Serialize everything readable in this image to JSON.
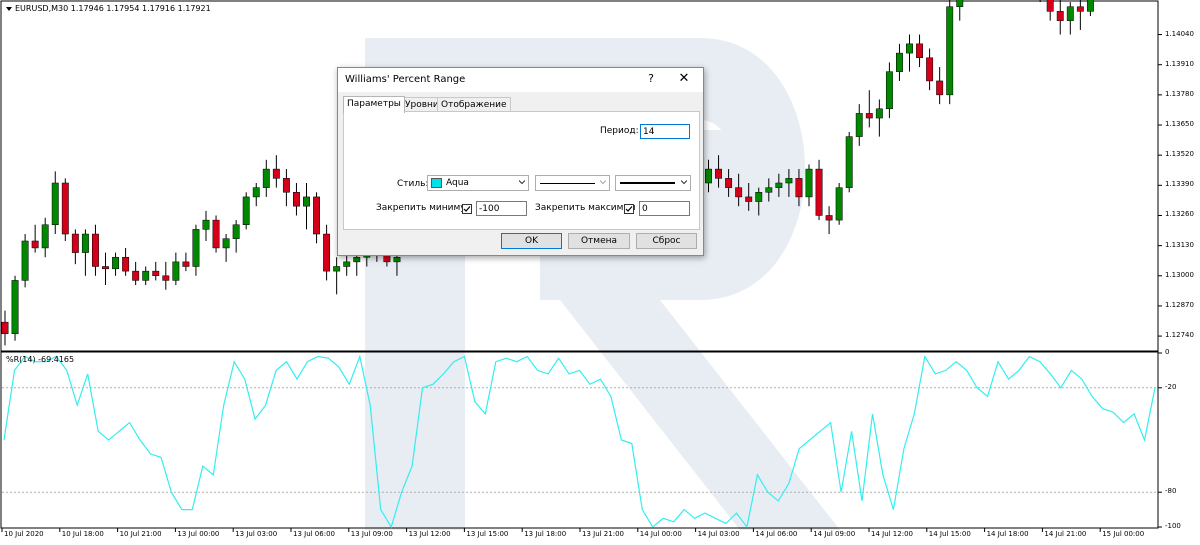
{
  "chart_header": {
    "symbol_line": "EURUSD,M30  1.17946 1.17954 1.17916 1.17921"
  },
  "indicator_header": {
    "text": "%R(14) -69.4165"
  },
  "price_axis": [
    "1.14040",
    "1.13910",
    "1.13780",
    "1.13650",
    "1.13520",
    "1.13390",
    "1.13260",
    "1.13130",
    "1.13000",
    "1.12870",
    "1.12740"
  ],
  "indicator_axis": [
    "0",
    "-20",
    "-80",
    "-100"
  ],
  "time_axis": [
    "10 Jul 2020",
    "10 Jul 18:00",
    "10 Jul 21:00",
    "13 Jul 00:00",
    "13 Jul 03:00",
    "13 Jul 06:00",
    "13 Jul 09:00",
    "13 Jul 12:00",
    "13 Jul 15:00",
    "13 Jul 18:00",
    "13 Jul 21:00",
    "14 Jul 00:00",
    "14 Jul 03:00",
    "14 Jul 06:00",
    "14 Jul 09:00",
    "14 Jul 12:00",
    "14 Jul 15:00",
    "14 Jul 18:00",
    "14 Jul 21:00",
    "15 Jul 00:00"
  ],
  "colors": {
    "bull": "#008800",
    "bear": "#d4001a",
    "wr_line": "#33eeee",
    "watermark": "#e8ecf3",
    "aqua_swatch": "#00e0e8"
  },
  "chart_data": {
    "type": "line",
    "price": {
      "ohlc": [
        [
          1.128,
          1.1285,
          1.127,
          1.1275
        ],
        [
          1.1275,
          1.13,
          1.1272,
          1.1298
        ],
        [
          1.1298,
          1.1318,
          1.1295,
          1.1315
        ],
        [
          1.1315,
          1.1322,
          1.131,
          1.1312
        ],
        [
          1.1312,
          1.1325,
          1.1308,
          1.1322
        ],
        [
          1.1322,
          1.1345,
          1.1318,
          1.134
        ],
        [
          1.134,
          1.1342,
          1.1315,
          1.1318
        ],
        [
          1.1318,
          1.132,
          1.1305,
          1.131
        ],
        [
          1.131,
          1.132,
          1.13,
          1.1318
        ],
        [
          1.1318,
          1.1322,
          1.13,
          1.1304
        ],
        [
          1.1304,
          1.131,
          1.1296,
          1.1303
        ],
        [
          1.1303,
          1.131,
          1.13,
          1.1308
        ],
        [
          1.1308,
          1.1312,
          1.13,
          1.1302
        ],
        [
          1.1302,
          1.1306,
          1.1296,
          1.1298
        ],
        [
          1.1298,
          1.1304,
          1.1296,
          1.1302
        ],
        [
          1.1302,
          1.1306,
          1.1298,
          1.13
        ],
        [
          1.13,
          1.1306,
          1.1294,
          1.1298
        ],
        [
          1.1298,
          1.131,
          1.1296,
          1.1306
        ],
        [
          1.1306,
          1.131,
          1.1302,
          1.1304
        ],
        [
          1.1304,
          1.1322,
          1.13,
          1.132
        ],
        [
          1.132,
          1.1328,
          1.1315,
          1.1324
        ],
        [
          1.1324,
          1.1326,
          1.131,
          1.1312
        ],
        [
          1.1312,
          1.1318,
          1.1306,
          1.1316
        ],
        [
          1.1316,
          1.1324,
          1.131,
          1.1322
        ],
        [
          1.1322,
          1.1336,
          1.132,
          1.1334
        ],
        [
          1.1334,
          1.134,
          1.133,
          1.1338
        ],
        [
          1.1338,
          1.135,
          1.1334,
          1.1346
        ],
        [
          1.1346,
          1.1352,
          1.1338,
          1.1342
        ],
        [
          1.1342,
          1.1346,
          1.133,
          1.1336
        ],
        [
          1.1336,
          1.134,
          1.1326,
          1.133
        ],
        [
          1.133,
          1.134,
          1.132,
          1.1334
        ],
        [
          1.1334,
          1.1336,
          1.1314,
          1.1318
        ],
        [
          1.1318,
          1.1322,
          1.1298,
          1.1302
        ],
        [
          1.1302,
          1.1308,
          1.1292,
          1.1304
        ],
        [
          1.1304,
          1.1312,
          1.13,
          1.1306
        ],
        [
          1.1306,
          1.1312,
          1.13,
          1.1308
        ],
        [
          1.1308,
          1.1316,
          1.1304,
          1.1312
        ],
        [
          1.1312,
          1.1318,
          1.1306,
          1.131
        ],
        [
          1.131,
          1.1316,
          1.1304,
          1.1306
        ],
        [
          1.1306,
          1.1312,
          1.13,
          1.1308
        ],
        [
          1.1308,
          1.1314,
          1.1302,
          1.1304
        ],
        [
          1.1304,
          1.131,
          1.1298,
          1.1306
        ],
        [
          1.1306,
          1.1312,
          1.13,
          1.1304
        ],
        [
          1.1304,
          1.131,
          1.1298,
          1.1302
        ],
        [
          1.1302,
          1.1308,
          1.1296,
          1.13
        ],
        [
          1.13,
          1.1306,
          1.1294,
          1.1298
        ],
        [
          1.1298,
          1.1304,
          1.1292,
          1.1296
        ],
        [
          1.1296,
          1.13,
          1.129,
          1.1294
        ],
        [
          1.1294,
          1.13,
          1.1288,
          1.1292
        ],
        [
          1.1292,
          1.1298,
          1.1286,
          1.129
        ],
        [
          1.129,
          1.1296,
          1.1284,
          1.1288
        ],
        [
          1.1288,
          1.1294,
          1.1282,
          1.1286
        ],
        [
          1.1286,
          1.1292,
          1.128,
          1.1284
        ],
        [
          1.1284,
          1.129,
          1.1278,
          1.1282
        ],
        [
          1.1282,
          1.1288,
          1.1276,
          1.128
        ],
        [
          1.128,
          1.1286,
          1.1274,
          1.1278
        ],
        [
          1.1278,
          1.1284,
          1.1272,
          1.1276
        ],
        [
          1.1276,
          1.1282,
          1.127,
          1.1274
        ],
        [
          1.1274,
          1.128,
          1.1268,
          1.1272
        ],
        [
          1.1272,
          1.1278,
          1.1266,
          1.127
        ],
        [
          1.127,
          1.1276,
          1.1264,
          1.1268
        ],
        [
          1.1268,
          1.1274,
          1.1262,
          1.1266
        ],
        [
          1.1266,
          1.1272,
          1.126,
          1.1264
        ],
        [
          1.1264,
          1.127,
          1.1258,
          1.1262
        ],
        [
          1.1262,
          1.1268,
          1.1256,
          1.126
        ],
        [
          1.126,
          1.1266,
          1.1254,
          1.1258
        ],
        [
          1.1258,
          1.1264,
          1.1252,
          1.1256
        ],
        [
          1.1256,
          1.1262,
          1.125,
          1.1254
        ],
        [
          1.1254,
          1.126,
          1.1248,
          1.1252
        ],
        [
          1.1252,
          1.1258,
          1.1246,
          1.125
        ],
        [
          1.134,
          1.135,
          1.1336,
          1.1346
        ],
        [
          1.1346,
          1.1352,
          1.1338,
          1.1342
        ],
        [
          1.1342,
          1.1346,
          1.1334,
          1.1338
        ],
        [
          1.1338,
          1.1344,
          1.133,
          1.1334
        ],
        [
          1.1334,
          1.134,
          1.1328,
          1.1332
        ],
        [
          1.1332,
          1.1338,
          1.1326,
          1.1336
        ],
        [
          1.1336,
          1.1342,
          1.1332,
          1.1338
        ],
        [
          1.1338,
          1.1344,
          1.1334,
          1.134
        ],
        [
          1.134,
          1.1346,
          1.1334,
          1.1342
        ],
        [
          1.1342,
          1.1346,
          1.133,
          1.1334
        ],
        [
          1.1334,
          1.1348,
          1.133,
          1.1346
        ],
        [
          1.1346,
          1.135,
          1.1324,
          1.1326
        ],
        [
          1.1326,
          1.133,
          1.1318,
          1.1324
        ],
        [
          1.1324,
          1.134,
          1.1322,
          1.1338
        ],
        [
          1.1338,
          1.1362,
          1.1336,
          1.136
        ],
        [
          1.136,
          1.1374,
          1.1356,
          1.137
        ],
        [
          1.137,
          1.138,
          1.1364,
          1.1368
        ],
        [
          1.1368,
          1.1376,
          1.136,
          1.1372
        ],
        [
          1.1372,
          1.1392,
          1.1368,
          1.1388
        ],
        [
          1.1388,
          1.14,
          1.1384,
          1.1396
        ],
        [
          1.1396,
          1.1404,
          1.1388,
          1.14
        ],
        [
          1.14,
          1.1404,
          1.139,
          1.1394
        ],
        [
          1.1394,
          1.1398,
          1.138,
          1.1384
        ],
        [
          1.1384,
          1.139,
          1.1374,
          1.1378
        ],
        [
          1.1378,
          1.142,
          1.1374,
          1.1416
        ],
        [
          1.1416,
          1.144,
          1.141,
          1.1436
        ],
        [
          1.1436,
          1.1444,
          1.1428,
          1.1432
        ],
        [
          1.1432,
          1.1438,
          1.142,
          1.1424
        ],
        [
          1.1424,
          1.145,
          1.142,
          1.1446
        ],
        [
          1.1446,
          1.1452,
          1.1436,
          1.144
        ],
        [
          1.144,
          1.1446,
          1.1432,
          1.1438
        ],
        [
          1.1438,
          1.1442,
          1.1426,
          1.143
        ],
        [
          1.143,
          1.144,
          1.1424,
          1.1436
        ],
        [
          1.1436,
          1.144,
          1.1418,
          1.1422
        ],
        [
          1.1422,
          1.1426,
          1.141,
          1.1414
        ],
        [
          1.1414,
          1.142,
          1.1404,
          1.141
        ],
        [
          1.141,
          1.1418,
          1.1404,
          1.1416
        ],
        [
          1.1416,
          1.142,
          1.1406,
          1.1414
        ],
        [
          1.1414,
          1.1432,
          1.1412,
          1.143
        ],
        [
          1.143,
          1.1436,
          1.1422,
          1.1426
        ],
        [
          1.1426,
          1.144,
          1.142,
          1.1436
        ]
      ],
      "ylim": [
        1.1268,
        1.1412
      ]
    },
    "series": [
      {
        "name": "%R(14)",
        "values": [
          -50,
          -10,
          -2,
          -5,
          -5,
          -2,
          -10,
          -30,
          -12,
          -45,
          -50,
          -45,
          -40,
          -50,
          -58,
          -60,
          -80,
          -90,
          -90,
          -65,
          -70,
          -30,
          -5,
          -15,
          -38,
          -30,
          -10,
          -5,
          -15,
          -5,
          -2,
          -3,
          -8,
          -18,
          -2,
          -30,
          -90,
          -100,
          -80,
          -65,
          -20,
          -18,
          -12,
          -5,
          -2,
          -28,
          -35,
          -5,
          -3,
          -5,
          -2,
          -10,
          -12,
          -3,
          -12,
          -10,
          -18,
          -15,
          -25,
          -50,
          -52,
          -90,
          -100,
          -95,
          -97,
          -90,
          -95,
          -92,
          -95,
          -98,
          -92,
          -100,
          -70,
          -80,
          -85,
          -75,
          -55,
          -50,
          -45,
          -40,
          -80,
          -45,
          -85,
          -35,
          -70,
          -90,
          -55,
          -35,
          -2,
          -12,
          -10,
          -5,
          -10,
          -20,
          -25,
          -5,
          -15,
          -10,
          -2,
          -5,
          -12,
          -20,
          -10,
          -15,
          -25,
          -32,
          -34,
          -40,
          -35,
          -50,
          -20
        ]
      }
    ],
    "xlabel": "",
    "ylabel": "",
    "ylim": [
      -100,
      0
    ],
    "levels": [
      -20,
      -80
    ],
    "grid": false
  },
  "watermark": {
    "logo_text": "R"
  },
  "dialog": {
    "title": "Williams' Percent Range",
    "help_label": "?",
    "close_label": "✕",
    "tabs": [
      {
        "label": "Параметры",
        "active": true
      },
      {
        "label": "Уровни",
        "active": false
      },
      {
        "label": "Отображение",
        "active": false
      }
    ],
    "period": {
      "label": "Период:",
      "value": "14"
    },
    "style": {
      "label": "Стиль:",
      "color_name": "Aqua"
    },
    "fix_min": {
      "label": "Закрепить минимум",
      "checked": true,
      "value": "-100"
    },
    "fix_max": {
      "label": "Закрепить максимум",
      "checked": true,
      "value": "0"
    },
    "buttons": {
      "ok": "OK",
      "cancel": "Отмена",
      "reset": "Сброс"
    }
  }
}
